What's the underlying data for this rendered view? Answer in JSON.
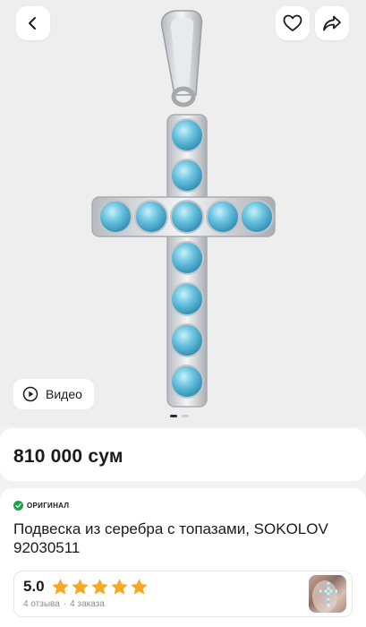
{
  "gallery": {
    "video_label": "Видео",
    "dots_count": 2,
    "active_dot": 0,
    "stone_color": "#5ab8d6",
    "metal_color": "#d9dce0"
  },
  "price": {
    "value": "810 000 сум"
  },
  "product": {
    "badge": "ОРИГИНАЛ",
    "badge_color": "#1fa34a",
    "title": "Подвеска из серебра с топазами, SOKOLOV 92030511"
  },
  "rating": {
    "value": "5.0",
    "stars": 5,
    "star_color": "#f7a823",
    "reviews": "4 отзыва",
    "separator": "·",
    "orders": "4 заказа"
  },
  "icons": {
    "back": "chevron-left-icon",
    "favorite": "heart-icon",
    "share": "share-arrow-icon",
    "video": "play-icon",
    "badge": "verified-check-icon",
    "star": "star-icon"
  }
}
